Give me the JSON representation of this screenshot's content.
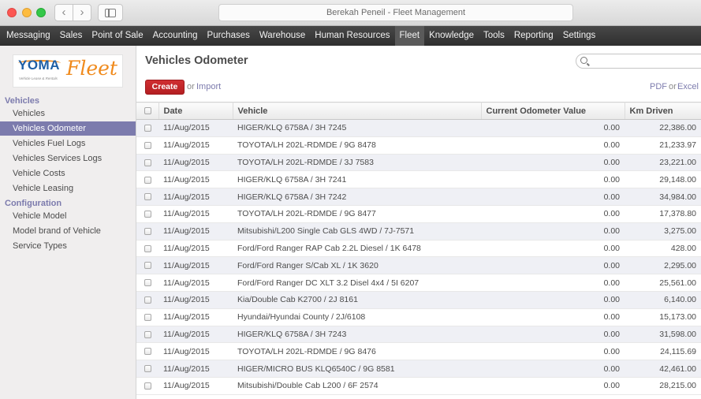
{
  "window": {
    "title": "Berekah Peneil - Fleet Management"
  },
  "main_menu": [
    "Messaging",
    "Sales",
    "Point of Sale",
    "Accounting",
    "Purchases",
    "Warehouse",
    "Human Resources",
    "Fleet",
    "Knowledge",
    "Tools",
    "Reporting",
    "Settings"
  ],
  "active_menu": "Fleet",
  "logo": {
    "brand": "YOMA",
    "product": "Fleet",
    "tagline": "Vehicle Lease & Rentals",
    "colors": {
      "brand": "#1f5fa6",
      "product": "#f08a1c"
    }
  },
  "sidebar": {
    "sections": [
      {
        "label": "Vehicles",
        "items": [
          "Vehicles",
          "Vehicles Odometer",
          "Vehicles Fuel Logs",
          "Vehicles Services Logs",
          "Vehicle Costs",
          "Vehicle Leasing"
        ]
      },
      {
        "label": "Configuration",
        "items": [
          "Vehicle Model",
          "Model brand of Vehicle",
          "Service Types"
        ]
      }
    ],
    "active_item": "Vehicles Odometer"
  },
  "page": {
    "title": "Vehicles Odometer",
    "search_placeholder": "",
    "create_label": "Create",
    "or_label": "or",
    "import_label": "Import",
    "pdf_label": "PDF",
    "excel_label": "Excel"
  },
  "table": {
    "columns": [
      "Date",
      "Vehicle",
      "Current Odometer Value",
      "Km Driven"
    ],
    "rows": [
      [
        "11/Aug/2015",
        "HIGER/KLQ 6758A / 3H 7245",
        "0.00",
        "22,386.00"
      ],
      [
        "11/Aug/2015",
        "TOYOTA/LH 202L-RDMDE / 9G 8478",
        "0.00",
        "21,233.97"
      ],
      [
        "11/Aug/2015",
        "TOYOTA/LH 202L-RDMDE / 3J 7583",
        "0.00",
        "23,221.00"
      ],
      [
        "11/Aug/2015",
        "HIGER/KLQ 6758A / 3H 7241",
        "0.00",
        "29,148.00"
      ],
      [
        "11/Aug/2015",
        "HIGER/KLQ 6758A / 3H 7242",
        "0.00",
        "34,984.00"
      ],
      [
        "11/Aug/2015",
        "TOYOTA/LH 202L-RDMDE / 9G 8477",
        "0.00",
        "17,378.80"
      ],
      [
        "11/Aug/2015",
        "Mitsubishi/L200 Single Cab GLS 4WD / 7J-7571",
        "0.00",
        "3,275.00"
      ],
      [
        "11/Aug/2015",
        "Ford/Ford Ranger RAP Cab 2.2L Diesel / 1K 6478",
        "0.00",
        "428.00"
      ],
      [
        "11/Aug/2015",
        "Ford/Ford Ranger S/Cab XL / 1K 3620",
        "0.00",
        "2,295.00"
      ],
      [
        "11/Aug/2015",
        "Ford/Ford Ranger DC XLT 3.2 Disel 4x4 / 5I 6207",
        "0.00",
        "25,561.00"
      ],
      [
        "11/Aug/2015",
        "Kia/Double Cab K2700 / 2J 8161",
        "0.00",
        "6,140.00"
      ],
      [
        "11/Aug/2015",
        "Hyundai/Hyundai County / 2J/6108",
        "0.00",
        "15,173.00"
      ],
      [
        "11/Aug/2015",
        "HIGER/KLQ 6758A / 3H 7243",
        "0.00",
        "31,598.00"
      ],
      [
        "11/Aug/2015",
        "TOYOTA/LH 202L-RDMDE / 9G 8476",
        "0.00",
        "24,115.69"
      ],
      [
        "11/Aug/2015",
        "HIGER/MICRO BUS KLQ6540C / 9G 8581",
        "0.00",
        "42,461.00"
      ],
      [
        "11/Aug/2015",
        "Mitsubishi/Double Cab L200 / 6F 2574",
        "0.00",
        "28,215.00"
      ]
    ]
  },
  "colors": {
    "accent": "#7c7bad",
    "create_button": "#c0262a",
    "menu_bar": "#3a3a3a"
  }
}
